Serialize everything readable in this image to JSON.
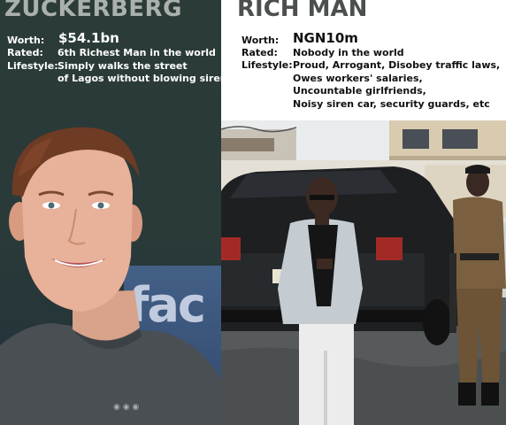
{
  "left": {
    "title": "ZUCKERBERG",
    "worth_label": "Worth:",
    "worth_value": "$54.1bn",
    "rated_label": "Rated:",
    "rated_value": "6th Richest Man in the world",
    "lifestyle_label": "Lifestyle:",
    "lifestyle_lines": [
      "Simply walks the street",
      "of Lagos without blowing siren"
    ],
    "background_text": "fac"
  },
  "right": {
    "title": "RICH MAN",
    "worth_label": "Worth:",
    "worth_value": "NGN10m",
    "rated_label": "Rated:",
    "rated_value": "Nobody in the world",
    "lifestyle_label": "Lifestyle:",
    "lifestyle_lines": [
      "Proud, Arrogant, Disobey traffic laws,",
      "Owes workers' salaries,",
      "Uncountable girlfriends,",
      "Noisy siren car, security guards, etc"
    ]
  },
  "colors": {
    "left_bg": "#2a3a39",
    "left_title": "#aab1ad",
    "right_bg": "#ffffff",
    "right_title": "#4b4f4d"
  }
}
